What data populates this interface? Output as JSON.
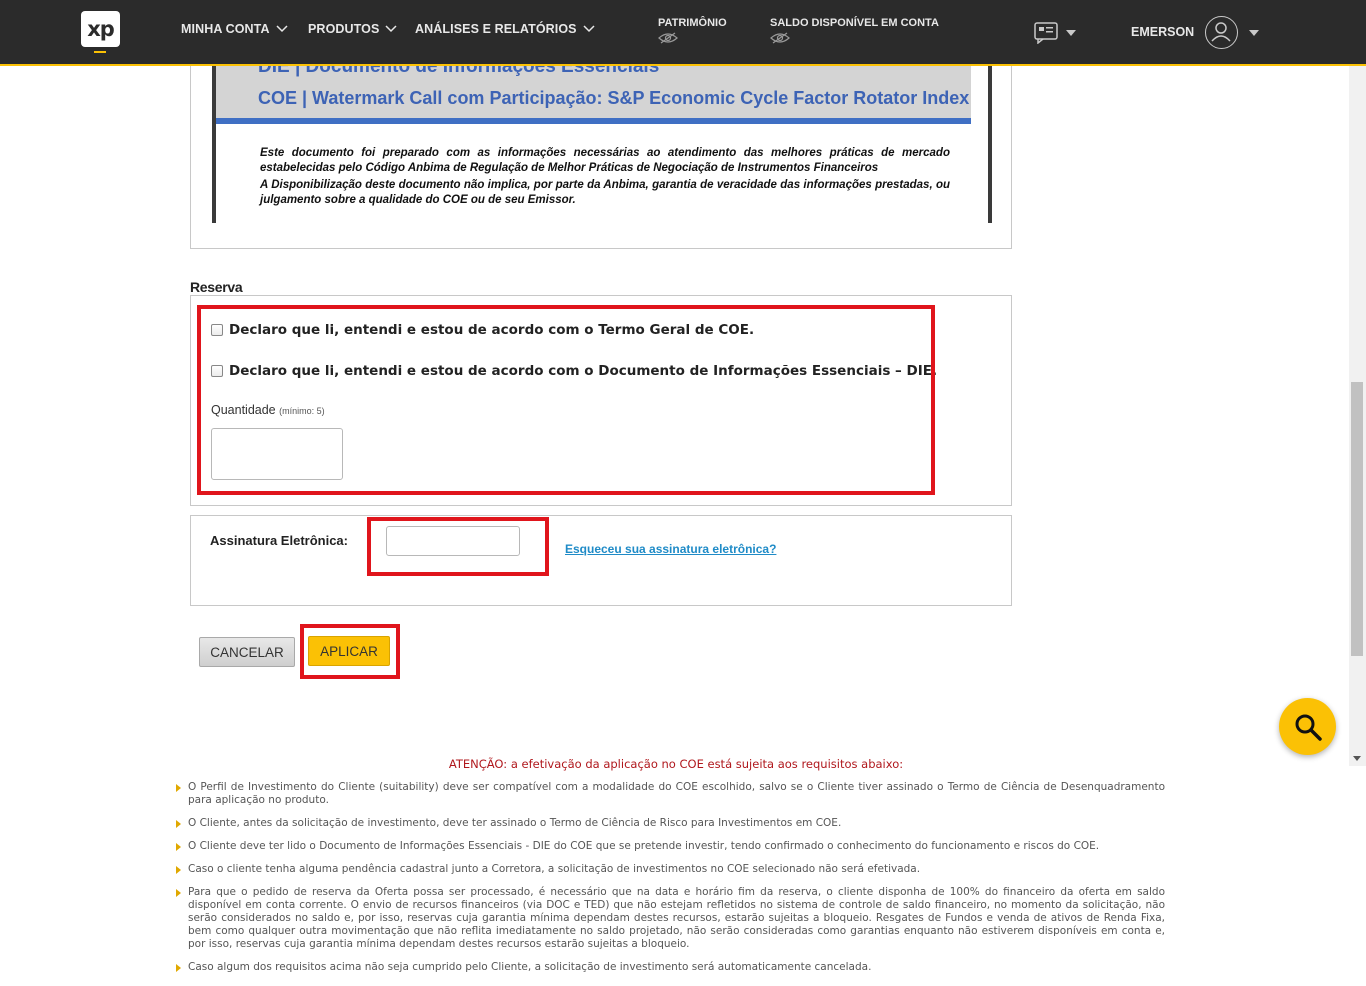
{
  "nav": {
    "logo": "xp",
    "items": [
      "MINHA CONTA",
      "PRODUTOS",
      "ANÁLISES E RELATÓRIOS"
    ],
    "balances": [
      "PATRIMÔNIO",
      "SALDO DISPONÍVEL EM CONTA"
    ],
    "user": "EMERSON"
  },
  "doc": {
    "die_title": "DIE  | Documento de Informações Essenciais",
    "coe_title": "COE | Watermark Call com Participação: S&P Economic Cycle Factor Rotator Index",
    "para1": "Este documento foi preparado com as informações necessárias ao atendimento das melhores práticas de mercado estabelecidas pelo Código Anbima de Regulação de Melhor Práticas de Negociação de Instrumentos Financeiros",
    "para2": "A Disponibilização deste documento não implica, por parte da Anbima, garantia de veracidade das informações prestadas, ou julgamento sobre a qualidade do COE ou de seu Emissor."
  },
  "reserva": {
    "title": "Reserva",
    "check1": "Declaro que li, entendi e estou de acordo com o Termo Geral de COE.",
    "check2": "Declaro que li, entendi e estou de acordo com o Documento de Informações Essenciais – DIE.",
    "qty_label": "Quantidade",
    "qty_hint": "(mínimo: 5)",
    "qty_value": ""
  },
  "signature": {
    "label": "Assinatura Eletrônica:",
    "value": "",
    "forgot_link": "Esqueceu sua assinatura eletrônica?"
  },
  "buttons": {
    "cancel": "CANCELAR",
    "apply": "APLICAR"
  },
  "attention": {
    "title": "ATENÇÃO: a efetivação da aplicação no COE está sujeita aos requisitos abaixo:",
    "items": [
      "O Perfil de Investimento do Cliente (suitability) deve ser compatível com a modalidade do COE escolhido, salvo se o Cliente tiver assinado o Termo de Ciência de Desenquadramento para aplicação no produto.",
      "O Cliente, antes da solicitação de investimento, deve ter assinado o Termo de Ciência de Risco para Investimentos em COE.",
      "O Cliente deve ter lido o Documento de Informações Essenciais - DIE do COE que se pretende investir, tendo confirmado o conhecimento do funcionamento e riscos do COE.",
      "Caso o cliente tenha alguma pendência cadastral junto a Corretora, a solicitação de investimentos no COE selecionado não será efetivada.",
      "Para que o pedido de reserva da Oferta possa ser processado, é necessário que na data e horário fim da reserva, o cliente disponha de 100% do financeiro da oferta em saldo disponível em conta corrente. O envio de recursos financeiros (via DOC e TED) que não estejam refletidos no sistema de controle de saldo financeiro, no momento da solicitação, não serão considerados no saldo e, por isso, reservas cuja garantia mínima dependam destes recursos, estarão sujeitas a bloqueio. Resgates de Fundos e venda de ativos de Renda Fixa, bem como qualquer outra movimentação que não reflita imediatamente no saldo projetado, não serão consideradas como garantias enquanto não estiverem disponíveis em conta e, por isso, reservas cuja garantia mínima dependam destes recursos estarão sujeitas a bloqueio.",
      "Caso algum dos requisitos acima não seja cumprido pelo Cliente, a solicitação de investimento será automaticamente cancelada."
    ]
  },
  "colors": {
    "brand_yellow": "#fbc105",
    "nav_bg": "#2b2b2b",
    "highlight_red": "#e0151c",
    "link_blue": "#1f8bc7",
    "attention_red": "#b0181d"
  }
}
